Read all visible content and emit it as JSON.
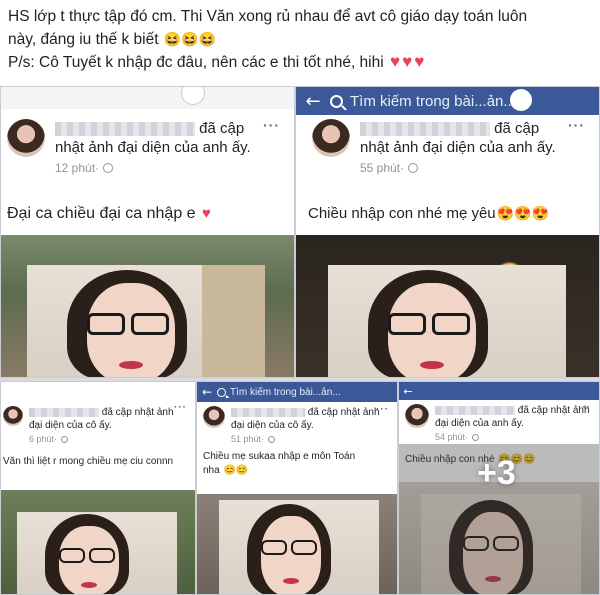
{
  "caption": {
    "line1": "HS lớp t thực tập đó cm. Thi Văn xong rủ nhau để avt cô giáo dạy toán luôn",
    "line2": "này, đáng iu thế k biết",
    "line3": "P/s: Cô Tuyết k nhập đc đâu, nên các e thi tốt nhé, hihi"
  },
  "tiles": [
    {
      "action": "đã cập nhật ảnh đại diện của anh ấy.",
      "time": "12 phút",
      "text": "Đại ca chiều đại ca nhập e"
    },
    {
      "search": "Tìm kiếm trong bài...ản...",
      "action": "đã cập nhật ảnh đại diện của anh ấy.",
      "time": "55 phút",
      "text": "Chiều nhập con nhé mẹ yêu"
    },
    {
      "action": "đã cập nhật ảnh đại diện của cô ấy.",
      "time": "6 phút",
      "text": "Văn thì liệt r mong chiều mẹ ciu connn"
    },
    {
      "search": "Tìm kiếm trong bài...ản...",
      "action": "đã cập nhật ảnh đại diện của cô ấy.",
      "time": "51 phút",
      "text_line1": "Chiều mẹ sukaa nhập e môn Toán",
      "text_line2": "nha"
    },
    {
      "action": "đã cập nhật ảnh đại diện của anh ấy.",
      "time": "54 phút",
      "text": "Chiều nhập con nhé",
      "more": "+3"
    }
  ],
  "icons": {
    "more": "ellipsis",
    "back": "←",
    "heart": "♥",
    "emoji": "☺"
  },
  "colors": {
    "facebook_blue": "#3b5998",
    "heart": "#e8435b",
    "meta_gray": "#90949c"
  }
}
